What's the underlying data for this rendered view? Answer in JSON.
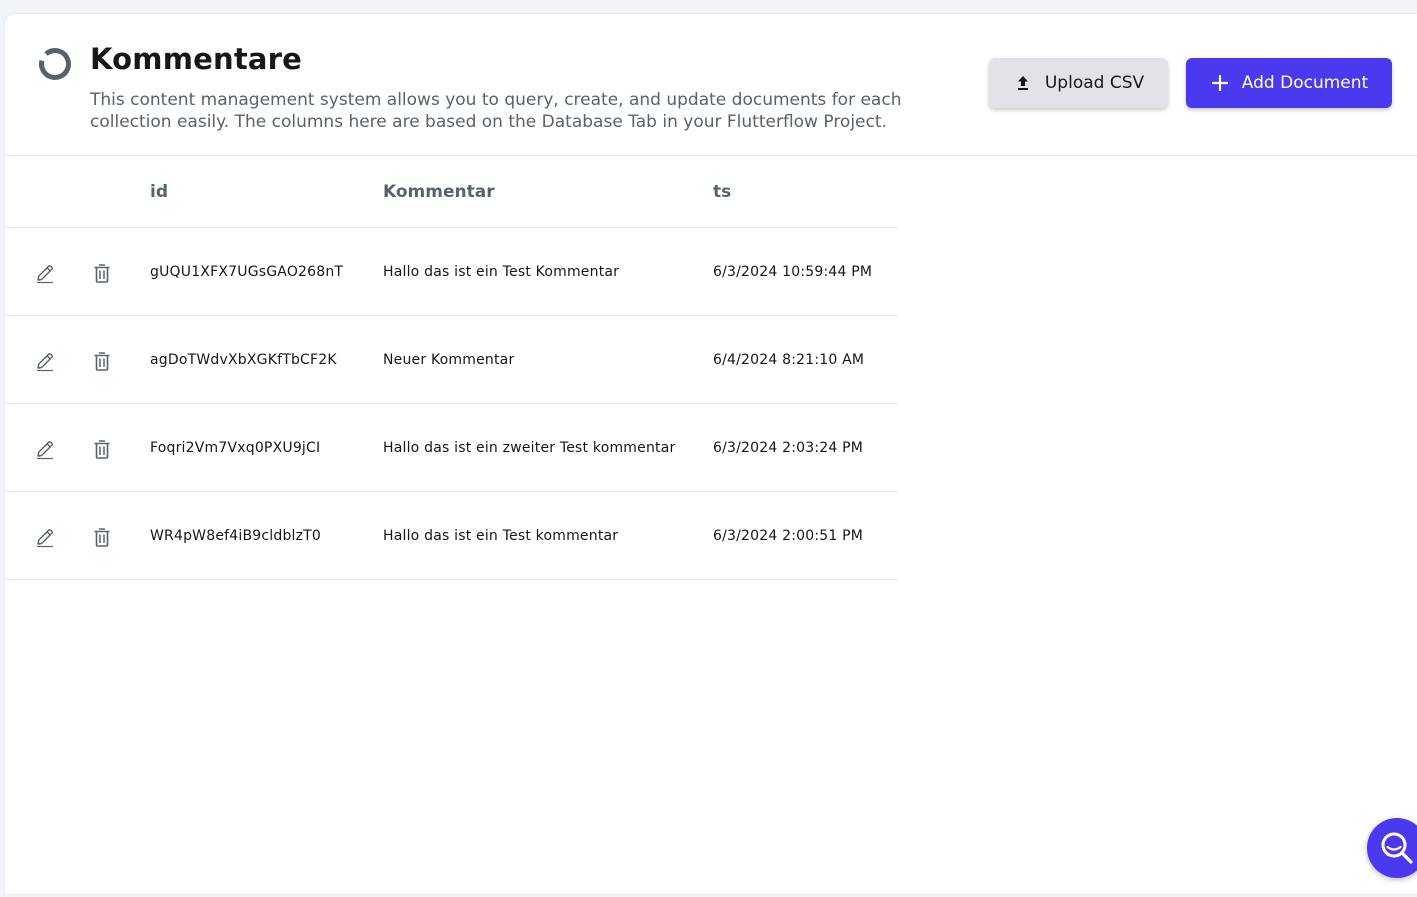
{
  "header": {
    "title": "Kommentare",
    "description": "This content management system allows you to query, create, and update documents for each collection easily. The columns here are based on the Database Tab in your Flutterflow Project.",
    "collection_icon": "loading-circle-icon"
  },
  "actions": {
    "upload_label": "Upload CSV",
    "upload_icon": "upload-icon",
    "add_label": "Add Document",
    "add_icon": "plus-icon"
  },
  "table": {
    "columns": [
      "id",
      "Kommentar",
      "ts"
    ],
    "row_actions": [
      "edit-icon",
      "trash-icon"
    ],
    "rows": [
      {
        "id": "gUQU1XFX7UGsGAO268nT",
        "kommentar": "Hallo das ist ein Test Kommentar",
        "ts": "6/3/2024 10:59:44 PM"
      },
      {
        "id": "agDoTWdvXbXGKfTbCF2K",
        "kommentar": "Neuer Kommentar",
        "ts": "6/4/2024 8:21:10 AM"
      },
      {
        "id": "Foqri2Vm7Vxq0PXU9jCI",
        "kommentar": "Hallo das ist ein zweiter Test kommentar",
        "ts": "6/3/2024 2:03:24 PM"
      },
      {
        "id": "WR4pW8ef4iB9cldblzT0",
        "kommentar": "Hallo das ist ein Test kommentar",
        "ts": "6/3/2024 2:00:51 PM"
      }
    ]
  },
  "support_button": {
    "icon": "search-icon"
  },
  "colors": {
    "primary": "#4b39ef",
    "secondary_button": "#e1e3e6",
    "text_secondary": "#57636c",
    "divider": "#e3e6ea"
  }
}
